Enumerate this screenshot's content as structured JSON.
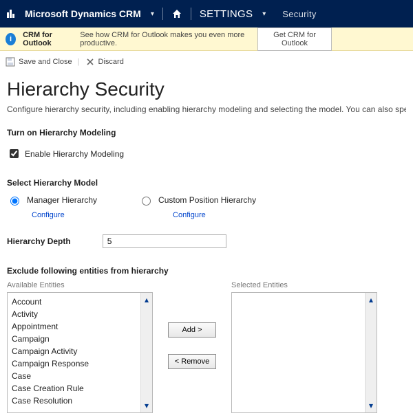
{
  "topbar": {
    "brand": "Microsoft Dynamics CRM",
    "settings_label": "SETTINGS",
    "breadcrumb": "Security"
  },
  "notice": {
    "bold": "CRM for Outlook",
    "text": "See how CRM for Outlook makes you even more productive.",
    "button": "Get CRM for Outlook"
  },
  "cmd": {
    "save_close": "Save and Close",
    "discard": "Discard"
  },
  "page": {
    "title": "Hierarchy Security",
    "subtitle": "Configure hierarchy security, including enabling hierarchy modeling and selecting the model. You can also specify how deep the hierarchy goes."
  },
  "modeling": {
    "heading": "Turn on Hierarchy Modeling",
    "checkbox_label": "Enable Hierarchy Modeling",
    "checked": true
  },
  "model": {
    "heading": "Select Hierarchy Model",
    "manager": "Manager Hierarchy",
    "custom": "Custom Position Hierarchy",
    "configure": "Configure",
    "selected": "manager"
  },
  "depth": {
    "label": "Hierarchy Depth",
    "value": "5"
  },
  "exclude": {
    "heading": "Exclude following entities from hierarchy",
    "available_label": "Available Entities",
    "selected_label": "Selected Entities",
    "add_btn": "Add >",
    "remove_btn": "< Remove",
    "available": [
      "Account",
      "Activity",
      "Appointment",
      "Campaign",
      "Campaign Activity",
      "Campaign Response",
      "Case",
      "Case Creation Rule",
      "Case Resolution"
    ],
    "selected": []
  }
}
